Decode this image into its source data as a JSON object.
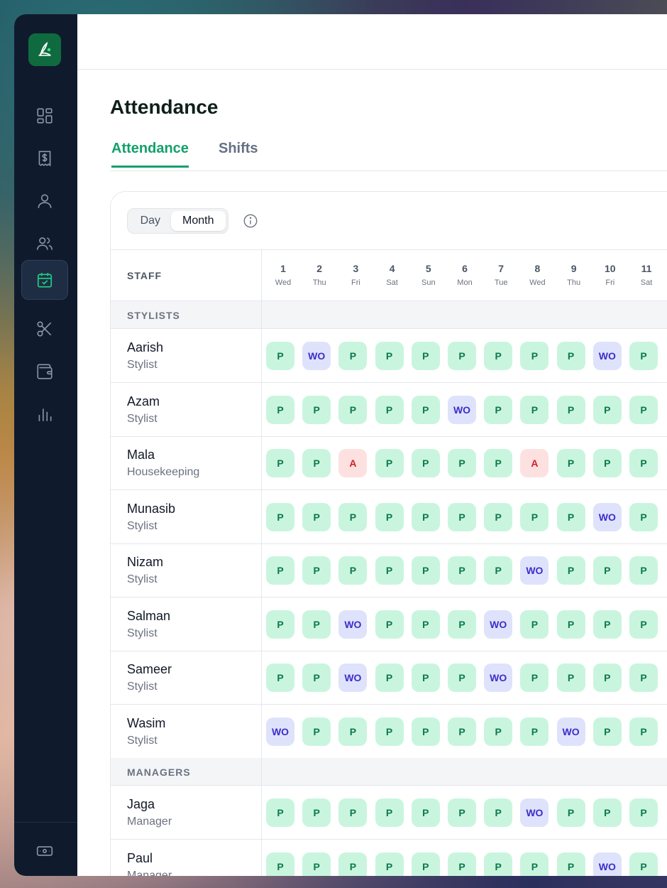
{
  "page": {
    "title": "Attendance"
  },
  "tabs": [
    {
      "label": "Attendance"
    },
    {
      "label": "Shifts"
    }
  ],
  "view_toggle": {
    "options": [
      "Day",
      "Month"
    ],
    "selected": "Month"
  },
  "grid": {
    "staff_header": "STAFF",
    "days": [
      {
        "num": "1",
        "name": "Wed"
      },
      {
        "num": "2",
        "name": "Thu"
      },
      {
        "num": "3",
        "name": "Fri"
      },
      {
        "num": "4",
        "name": "Sat"
      },
      {
        "num": "5",
        "name": "Sun"
      },
      {
        "num": "6",
        "name": "Mon"
      },
      {
        "num": "7",
        "name": "Tue"
      },
      {
        "num": "8",
        "name": "Wed"
      },
      {
        "num": "9",
        "name": "Thu"
      },
      {
        "num": "10",
        "name": "Fri"
      },
      {
        "num": "11",
        "name": "Sat"
      }
    ],
    "sections": [
      {
        "label": "STYLISTS",
        "staff": [
          {
            "name": "Aarish",
            "role": "Stylist",
            "marks": [
              "P",
              "WO",
              "P",
              "P",
              "P",
              "P",
              "P",
              "P",
              "P",
              "WO",
              "P"
            ]
          },
          {
            "name": "Azam",
            "role": "Stylist",
            "marks": [
              "P",
              "P",
              "P",
              "P",
              "P",
              "WO",
              "P",
              "P",
              "P",
              "P",
              "P"
            ]
          },
          {
            "name": "Mala",
            "role": "Housekeeping",
            "marks": [
              "P",
              "P",
              "A",
              "P",
              "P",
              "P",
              "P",
              "A",
              "P",
              "P",
              "P"
            ]
          },
          {
            "name": "Munasib",
            "role": "Stylist",
            "marks": [
              "P",
              "P",
              "P",
              "P",
              "P",
              "P",
              "P",
              "P",
              "P",
              "WO",
              "P"
            ]
          },
          {
            "name": "Nizam",
            "role": "Stylist",
            "marks": [
              "P",
              "P",
              "P",
              "P",
              "P",
              "P",
              "P",
              "WO",
              "P",
              "P",
              "P"
            ]
          },
          {
            "name": "Salman",
            "role": "Stylist",
            "marks": [
              "P",
              "P",
              "WO",
              "P",
              "P",
              "P",
              "WO",
              "P",
              "P",
              "P",
              "P"
            ]
          },
          {
            "name": "Sameer",
            "role": "Stylist",
            "marks": [
              "P",
              "P",
              "WO",
              "P",
              "P",
              "P",
              "WO",
              "P",
              "P",
              "P",
              "P"
            ]
          },
          {
            "name": "Wasim",
            "role": "Stylist",
            "marks": [
              "WO",
              "P",
              "P",
              "P",
              "P",
              "P",
              "P",
              "P",
              "WO",
              "P",
              "P"
            ]
          }
        ]
      },
      {
        "label": "MANAGERS",
        "staff": [
          {
            "name": "Jaga",
            "role": "Manager",
            "marks": [
              "P",
              "P",
              "P",
              "P",
              "P",
              "P",
              "P",
              "WO",
              "P",
              "P",
              "P"
            ]
          },
          {
            "name": "Paul",
            "role": "Manager",
            "marks": [
              "P",
              "P",
              "P",
              "P",
              "P",
              "P",
              "P",
              "P",
              "P",
              "WO",
              "P"
            ]
          }
        ]
      }
    ]
  },
  "sidebar": {
    "items": [
      {
        "icon": "dashboard-icon",
        "active": false
      },
      {
        "icon": "receipt-icon",
        "active": false
      },
      {
        "icon": "user-icon",
        "active": false
      },
      {
        "icon": "users-icon",
        "active": false
      },
      {
        "icon": "calendar-check-icon",
        "active": true
      },
      {
        "icon": "scissors-icon",
        "active": false
      },
      {
        "icon": "wallet-icon",
        "active": false
      },
      {
        "icon": "bar-chart-icon",
        "active": false
      }
    ],
    "bottom_icon": "cash-icon"
  },
  "colors": {
    "accent": "#12a06b",
    "present_bg": "#c9f5df",
    "present_fg": "#0e7a48",
    "weekoff_bg": "#dfe2fb",
    "weekoff_fg": "#3b2fc9",
    "absent_bg": "#fde1e1",
    "absent_fg": "#d32222",
    "sidebar_bg": "#0f1b2d"
  }
}
